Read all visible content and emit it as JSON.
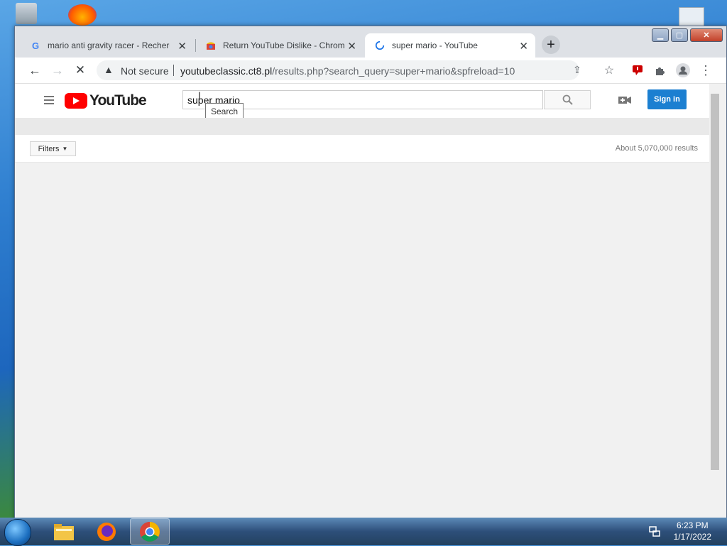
{
  "tabs": [
    {
      "title": "mario anti gravity racer - Recherche",
      "favicon": "google-g-icon"
    },
    {
      "title": "Return YouTube Dislike - Chrome Web Store",
      "favicon": "chrome-web-store-icon"
    },
    {
      "title": "super mario - YouTube",
      "favicon": "loading-spinner-icon"
    }
  ],
  "address_bar": {
    "security_text": "Not secure",
    "url_host": "youtubeclassic.ct8.pl",
    "url_path": "/results.php?search_query=super+mario&spfreload=10"
  },
  "youtube": {
    "logo_text": "YouTube",
    "search_value": "super mario",
    "search_tooltip": "Search",
    "sign_in_label": "Sign in",
    "filters_label": "Filters",
    "results_count": "About 5,070,000 results"
  },
  "taskbar": {
    "time": "6:23 PM",
    "date": "1/17/2022"
  },
  "colors": {
    "youtube_red": "#ff0000",
    "sign_in_blue": "#1b7fd1",
    "tab_strip": "#dee1e6",
    "page_background": "#f1f1f1"
  }
}
